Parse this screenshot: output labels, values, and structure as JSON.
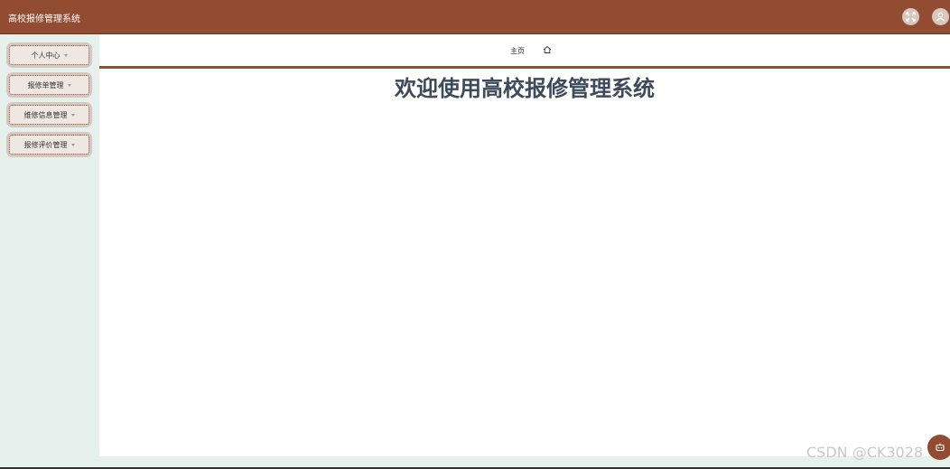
{
  "header": {
    "app_title": "高校报修管理系统",
    "actions": [
      {
        "icon": "fullscreen-icon"
      },
      {
        "icon": "user-icon"
      }
    ]
  },
  "sidebar": {
    "items": [
      {
        "label": "个人中心"
      },
      {
        "label": "报修单管理"
      },
      {
        "label": "维修信息管理"
      },
      {
        "label": "报修评价管理"
      }
    ]
  },
  "nav": {
    "home_label": "主页",
    "home_icon": "home-icon"
  },
  "main": {
    "welcome_text": "欢迎使用高校报修管理系统"
  },
  "watermark": "CSDN @CK3028",
  "colors": {
    "brand": "#924c32",
    "sidebar_bg": "#e6f0ec",
    "welcome_text": "#3d4a5a"
  }
}
